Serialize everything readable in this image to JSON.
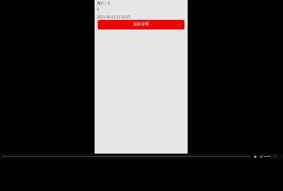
{
  "screen": {
    "line_1": "用户：1",
    "line_2": "1",
    "line_3": "2023-04-25 11:53:25",
    "button_label": "加好友啊"
  },
  "player": {
    "progress": 0.0,
    "play_icon": "▶",
    "volume_icon": "◂)",
    "fullscreen_icon": "⛶"
  },
  "colors": {
    "background": "#000000",
    "screen_bg": "#e6e6e6",
    "button_bg": "#f40000",
    "button_text": "#ffffff"
  }
}
